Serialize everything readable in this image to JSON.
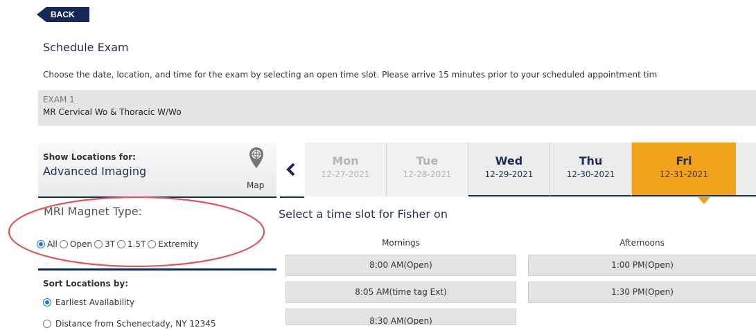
{
  "nav": {
    "back_label": "BACK"
  },
  "page": {
    "title": "Schedule Exam",
    "instructions": "Choose the date, location, and time for the exam by selecting an open time slot. Please arrive 15 minutes prior to your scheduled appointment tim"
  },
  "exam": {
    "label": "EXAM 1",
    "name": "MR Cervical Wo & Thoracic W/Wo"
  },
  "location": {
    "heading": "Show Locations for:",
    "name": "Advanced Imaging",
    "map_label": "Map",
    "map_icon": "map-pin-icon"
  },
  "days": [
    {
      "name": "Mon",
      "date": "12-27-2021",
      "state": "disabled"
    },
    {
      "name": "Tue",
      "date": "12-28-2021",
      "state": "disabled"
    },
    {
      "name": "Wed",
      "date": "12-29-2021",
      "state": "active"
    },
    {
      "name": "Thu",
      "date": "12-30-2021",
      "state": "active"
    },
    {
      "name": "Fri",
      "date": "12-31-2021",
      "state": "selected"
    }
  ],
  "mri": {
    "label": "MRI Magnet Type:",
    "options": [
      "All",
      "Open",
      "3T",
      "1.5T",
      "Extremity"
    ],
    "selected": "All"
  },
  "sort": {
    "heading": "Sort Locations by:",
    "options": [
      "Earliest Availability",
      "Distance from Schenectady, NY 12345"
    ],
    "selected": "Earliest Availability"
  },
  "slots": {
    "title": "Select a time slot for Fisher on",
    "mornings_label": "Mornings",
    "afternoons_label": "Afternoons",
    "mornings": [
      "8:00 AM(Open)",
      "8:05 AM(time tag Ext)",
      "8:30 AM(Open)"
    ],
    "afternoons": [
      "1:00 PM(Open)",
      "1:30 PM(Open)"
    ]
  },
  "colors": {
    "navy": "#14285a",
    "selected_day": "#f3a21c",
    "annotation": "#e05555",
    "radio_accent": "#1a73e8"
  }
}
